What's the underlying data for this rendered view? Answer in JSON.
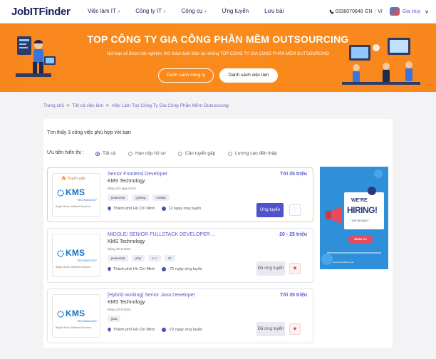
{
  "brand": {
    "logo": "JobITFinder"
  },
  "nav": {
    "links": [
      {
        "label": "Việc làm IT",
        "chevron": "›"
      },
      {
        "label": "Công ty IT",
        "chevron": "›"
      },
      {
        "label": "Công cụ",
        "chevron": "›"
      },
      {
        "label": "Ứng tuyển",
        "chevron": ""
      },
      {
        "label": "Lưu bài",
        "chevron": ""
      }
    ],
    "phone": "0338070648",
    "lang_en": "EN",
    "lang_vi": "VI",
    "user_name": "Gia Huy",
    "user_chevron": "∨"
  },
  "hero": {
    "title": "TOP CÔNG TY GIA CÔNG PHẦN MỀM OUTSOURCING",
    "subtitle": "Nơi bạn sẽ được trải nghiệm, thử thách bản thân tại những TOP CÔNG TY GIA CÔNG PHẦN MỀM OUTSOURCING",
    "btn_companies": "Danh sách công ty",
    "btn_jobs": "Danh sách việc làm"
  },
  "breadcrumb": {
    "home": "Trang chủ",
    "all_jobs": "Tất cả việc làm",
    "current": "Việc Làm Top Công Ty Gia Công Phần Mềm Outsourcing",
    "sep": ">"
  },
  "results": {
    "count_text": "Tìm thấy 3 công việc phù hợp với bạn"
  },
  "filter": {
    "label": "Ưu tiên hiển thị :",
    "options": [
      {
        "label": "Tất cả",
        "selected": true
      },
      {
        "label": "Hạn nộp hồ sơ",
        "selected": false
      },
      {
        "label": "Cần tuyển gấp",
        "selected": false
      },
      {
        "label": "Lương cao đến thấp",
        "selected": false
      }
    ]
  },
  "jobs": [
    {
      "hot": "Tuyển gấp",
      "title": "Senior Frontend Developer",
      "company": "KMS Technology",
      "posted": "Đăng 20 ngày trước",
      "tags": [
        "javascript",
        "golang",
        "nodejs"
      ],
      "location": "Thành phố Hồ Chí Minh",
      "deadline": "12 ngày ứng tuyển",
      "salary": "Tới 35 triệu",
      "apply_label": "Ứng tuyển",
      "applied": false,
      "favorited": false
    },
    {
      "hot": "",
      "title": "MIDDLE/ SENIOR FULLSTACK DEVELOPER ...",
      "company": "KMS Technology",
      "posted": "Đăng 22-9-2024",
      "tags": [
        "javascript",
        "php",
        "c++",
        "c#"
      ],
      "location": "Thành phố Hồ Chí Minh",
      "deadline": "-75 ngày ứng tuyển",
      "salary": "20 - 25 triệu",
      "apply_label": "Đã ứng tuyển",
      "applied": true,
      "favorited": true
    },
    {
      "hot": "",
      "title": "[Hybrid working] Senior Java Developer",
      "company": "KMS Technology",
      "posted": "Đăng 22-9-2024",
      "tags": [
        "java"
      ],
      "location": "Thành phố Hồ Chí Minh",
      "deadline": "-72 ngày ứng tuyển",
      "salary": "Tới 35 triệu",
      "apply_label": "Đã ứng tuyển",
      "applied": true,
      "favorited": true
    }
  ],
  "company_logo": {
    "wordmark": "KMS",
    "sub": "TECHNOLOGY",
    "tagline": "Bright Minds, Brilliant Solutions"
  },
  "banner": {
    "line1": "WE'RE",
    "line2": "HIRING!",
    "line3": "JOB VACANCY",
    "cta": "SEND CV",
    "footer": "www.yourlinkhere.com"
  },
  "colors": {
    "orange": "#f7871d",
    "primary": "#4f52cc",
    "link": "#5457c7",
    "kms_blue": "#1672c6",
    "hot": "#f06d1a"
  }
}
